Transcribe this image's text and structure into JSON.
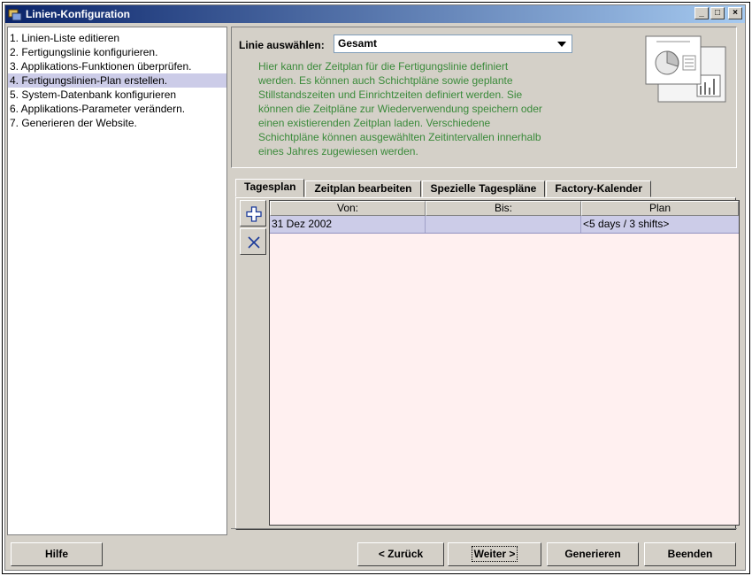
{
  "window": {
    "title": "Linien-Konfiguration",
    "controls": [
      "_",
      "□",
      "×"
    ]
  },
  "steps": [
    {
      "label": "1. Linien-Liste editieren",
      "active": false
    },
    {
      "label": "2. Fertigungslinie konfigurieren.",
      "active": false
    },
    {
      "label": "3. Applikations-Funktionen überprüfen.",
      "active": false
    },
    {
      "label": "4. Fertigungslinien-Plan erstellen.",
      "active": true
    },
    {
      "label": "5. System-Datenbank konfigurieren",
      "active": false
    },
    {
      "label": "6. Applikations-Parameter verändern.",
      "active": false
    },
    {
      "label": "7. Generieren der Website.",
      "active": false
    }
  ],
  "header": {
    "linie_label": "Linie auswählen:",
    "linie_value": "Gesamt",
    "description_lines": [
      "Hier kann der Zeitplan für die Fertigungslinie definiert",
      "werden. Es können auch Schichtpläne sowie geplante",
      "Stillstandszeiten und Einrichtzeiten definiert werden. Sie",
      "können die Zeitpläne zur Wiederverwendung speichern oder",
      "einen existierenden Zeitplan laden. Verschiedene",
      "Schichtpläne können ausgewählten Zeitintervallen innerhalb",
      "eines Jahres zugewiesen werden."
    ],
    "description_color": "#3a8a3a"
  },
  "tabs": [
    {
      "label": "Tagesplan",
      "active": true
    },
    {
      "label": "Zeitplan bearbeiten",
      "active": false
    },
    {
      "label": "Spezielle Tagespläne",
      "active": false
    },
    {
      "label": "Factory-Kalender",
      "active": false
    }
  ],
  "table": {
    "columns": [
      "Von:",
      "Bis:",
      "Plan"
    ],
    "rows": [
      [
        "31 Dez 2002",
        "",
        "<5 days / 3 shifts>"
      ]
    ]
  },
  "toolbar": {
    "add_icon": "plus-icon",
    "remove_icon": "x-icon"
  },
  "buttons": {
    "help": "Hilfe",
    "back": "< Zurück",
    "next": "Weiter >",
    "generate": "Generieren",
    "exit": "Beenden"
  },
  "colors": {
    "titlebar": "#0a246a",
    "selection": "#cccce8",
    "table_bg": "#fff0f0"
  }
}
